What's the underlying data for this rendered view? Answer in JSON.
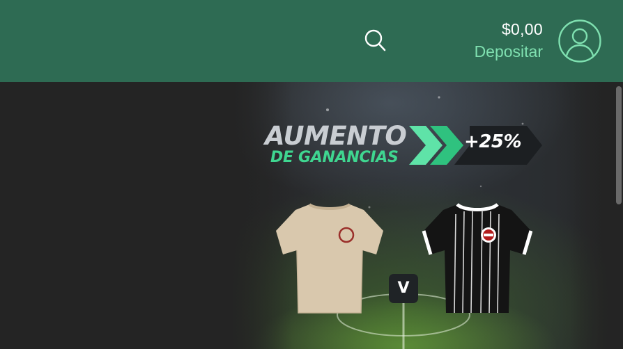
{
  "header": {
    "balance": "$0,00",
    "deposit_label": "Depositar",
    "search_icon": "search-icon",
    "account_icon": "user-account-icon"
  },
  "promo": {
    "title": "AUMENTO",
    "subtitle": "DE GANANCIAS",
    "boost": "+25%",
    "vs_label": "V"
  },
  "colors": {
    "header_bg": "#2e6b53",
    "accent_green": "#7fe0b0",
    "promo_green": "#3fd690",
    "page_bg": "#242424"
  }
}
